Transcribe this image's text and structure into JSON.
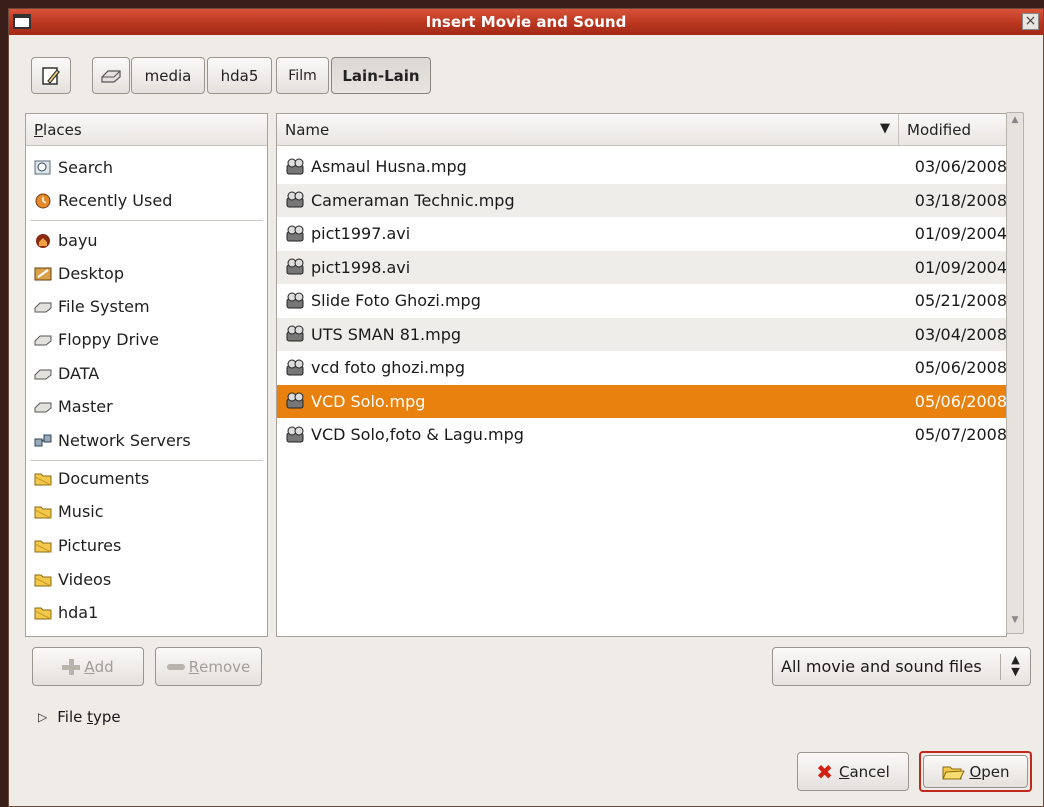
{
  "window": {
    "title": "Insert Movie and Sound",
    "close_glyph": "×"
  },
  "pathbar": {
    "segments": [
      "media",
      "hda5",
      "Film",
      "Lain-Lain"
    ]
  },
  "places": {
    "header": "Places",
    "header_mnemonic": "P",
    "items": [
      "Search",
      "Recently Used",
      "bayu",
      "Desktop",
      "File System",
      "Floppy Drive",
      "DATA",
      "Master",
      "Network Servers",
      "Documents",
      "Music",
      "Pictures",
      "Videos",
      "hda1"
    ]
  },
  "files": {
    "col_name": "Name",
    "col_modified": "Modified",
    "rows": [
      {
        "name": "Asmaul Husna.mpg",
        "modified": "03/06/2008"
      },
      {
        "name": "Cameraman Technic.mpg",
        "modified": "03/18/2008"
      },
      {
        "name": "pict1997.avi",
        "modified": "01/09/2004"
      },
      {
        "name": "pict1998.avi",
        "modified": "01/09/2004"
      },
      {
        "name": "Slide Foto Ghozi.mpg",
        "modified": "05/21/2008"
      },
      {
        "name": "UTS SMAN 81.mpg",
        "modified": "03/04/2008"
      },
      {
        "name": "vcd foto ghozi.mpg",
        "modified": "05/06/2008"
      },
      {
        "name": "VCD Solo.mpg",
        "modified": "05/06/2008"
      },
      {
        "name": "VCD Solo,foto & Lagu.mpg",
        "modified": "05/07/2008"
      }
    ],
    "selected_index": 7
  },
  "buttons": {
    "add": "Add",
    "add_mnemonic": "A",
    "add_rest": "dd",
    "remove": "Remove",
    "remove_mnemonic": "R",
    "remove_rest": "emove",
    "cancel_mnemonic": "C",
    "cancel_rest": "ancel",
    "open_mnemonic": "O",
    "open_rest": "pen"
  },
  "filter": {
    "selected": "All movie and sound files"
  },
  "filetype": {
    "pre": "File ",
    "mnemonic": "t",
    "post": "ype"
  },
  "colors": {
    "titlebar": "#b9361f",
    "selection": "#e8810e",
    "dialog_bg": "#efebe7",
    "default_button_border": "#c0281c"
  }
}
